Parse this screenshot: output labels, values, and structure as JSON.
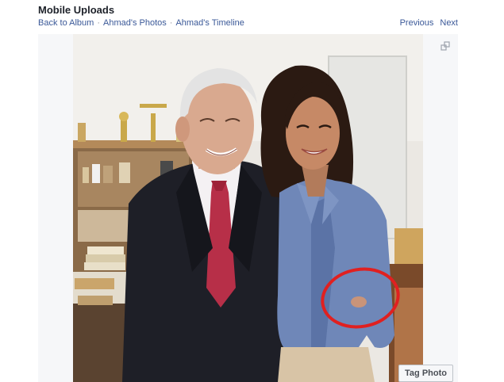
{
  "album": {
    "title": "Mobile Uploads"
  },
  "breadcrumb": {
    "back_to_album": "Back to Album",
    "photos": "Ahmad's Photos",
    "timeline": "Ahmad's Timeline",
    "separator": "·"
  },
  "nav": {
    "previous": "Previous",
    "next": "Next"
  },
  "photo": {
    "tag_label": "Tag Photo"
  },
  "icons": {
    "expand": "expand-icon"
  },
  "colors": {
    "link": "#3b5998",
    "annotation_circle": "#e02020"
  }
}
